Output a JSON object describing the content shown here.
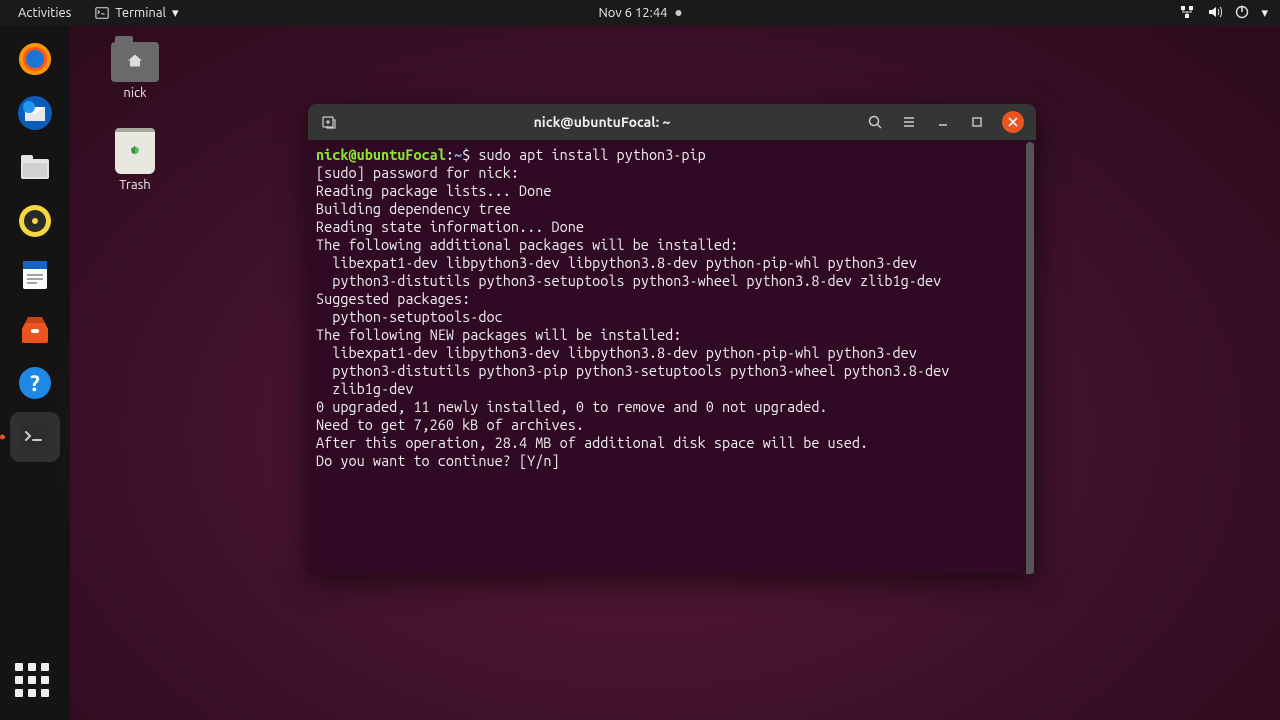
{
  "topbar": {
    "activities": "Activities",
    "app_label": "Terminal",
    "datetime": "Nov 6  12:44"
  },
  "desktop": {
    "home_label": "nick",
    "trash_label": "Trash"
  },
  "dock": {
    "items": [
      "firefox",
      "thunderbird",
      "files",
      "rhythmbox",
      "writer",
      "software",
      "help",
      "terminal"
    ]
  },
  "terminal": {
    "title": "nick@ubuntuFocal: ~",
    "prompt_user": "nick@ubuntuFocal",
    "prompt_sep": ":",
    "prompt_path": "~",
    "prompt_suffix": "$ ",
    "command": "sudo apt install python3-pip",
    "lines": [
      "[sudo] password for nick:",
      "Reading package lists... Done",
      "Building dependency tree",
      "Reading state information... Done",
      "The following additional packages will be installed:",
      "  libexpat1-dev libpython3-dev libpython3.8-dev python-pip-whl python3-dev",
      "  python3-distutils python3-setuptools python3-wheel python3.8-dev zlib1g-dev",
      "Suggested packages:",
      "  python-setuptools-doc",
      "The following NEW packages will be installed:",
      "  libexpat1-dev libpython3-dev libpython3.8-dev python-pip-whl python3-dev",
      "  python3-distutils python3-pip python3-setuptools python3-wheel python3.8-dev",
      "  zlib1g-dev",
      "0 upgraded, 11 newly installed, 0 to remove and 0 not upgraded.",
      "Need to get 7,260 kB of archives.",
      "After this operation, 28.4 MB of additional disk space will be used.",
      "Do you want to continue? [Y/n]"
    ]
  }
}
